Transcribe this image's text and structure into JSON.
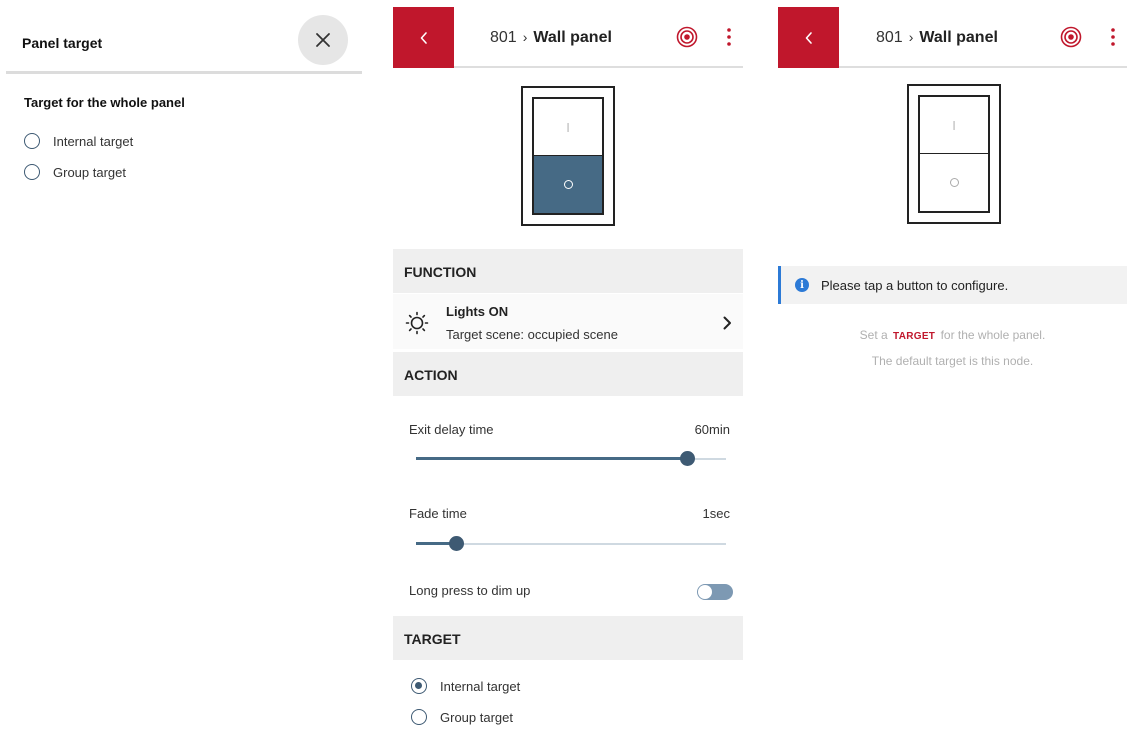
{
  "panel_target_sheet": {
    "title": "Panel target",
    "section_title": "Target for the whole panel",
    "options": [
      {
        "label": "Internal target",
        "selected": false
      },
      {
        "label": "Group target",
        "selected": false
      }
    ]
  },
  "header": {
    "node_number": "801",
    "separator": "›",
    "page_title": "Wall panel",
    "back_icon": "chevron-left-icon",
    "target_icon": "target-icon",
    "menu_icon": "more-vertical-icon",
    "brand_color": "#c0172c"
  },
  "switch": {
    "top_mark": "I",
    "bottom_mark": "O",
    "active_button": "bottom",
    "active_color": "#466a85"
  },
  "detail": {
    "function_header": "FUNCTION",
    "function_name": "Lights ON",
    "function_sub": "Target scene: occupied scene",
    "function_icon": "sun-icon",
    "action_header": "ACTION",
    "exit_delay": {
      "label": "Exit delay time",
      "value": "60min",
      "fraction": 0.875
    },
    "fade": {
      "label": "Fade time",
      "value": "1sec",
      "fraction": 0.13
    },
    "long_press": {
      "label": "Long press to dim up",
      "on": false
    },
    "target_header": "TARGET",
    "target_options": [
      {
        "label": "Internal target",
        "selected": true
      },
      {
        "label": "Group target",
        "selected": false
      }
    ]
  },
  "info": {
    "message": "Please tap a button to configure.",
    "hint_prefix": "Set a",
    "hint_keyword": "TARGET",
    "hint_suffix": "for the whole panel.",
    "hint_line2": "The default target is this node.",
    "info_color": "#2c7ad6"
  }
}
